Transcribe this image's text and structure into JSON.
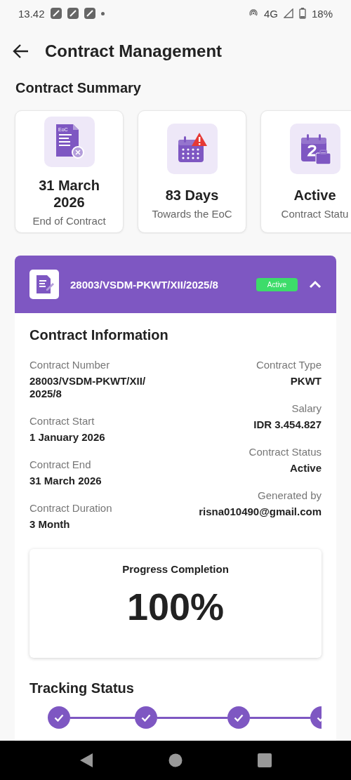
{
  "status_bar": {
    "time": "13.42",
    "network": "4G",
    "battery": "18%"
  },
  "header": {
    "title": "Contract Management"
  },
  "summary": {
    "title": "Contract Summary",
    "cards": [
      {
        "kind": "end",
        "icon_text": "EoC",
        "value": "31 March 2026",
        "caption": "End of Contract"
      },
      {
        "kind": "days",
        "value": "83 Days",
        "caption": "Towards the EoC"
      },
      {
        "kind": "status",
        "value": "Active",
        "caption": "Contract Statu"
      }
    ]
  },
  "contract": {
    "number": "28003/VSDM-PKWT/XII/2025/8",
    "badge": "Active",
    "expanded": true,
    "info_title": "Contract Information",
    "left": [
      {
        "label": "Contract Number",
        "value": "28003/VSDM-PKWT/XII/ 2025/8"
      },
      {
        "label": "Contract Start",
        "value": "1 January 2026"
      },
      {
        "label": "Contract End",
        "value": "31 March 2026"
      },
      {
        "label": "Contract Duration",
        "value": "3 Month"
      }
    ],
    "right": [
      {
        "label": "Contract Type",
        "value": "PKWT"
      },
      {
        "label": "Salary",
        "value": "IDR 3.454.827"
      },
      {
        "label": "Contract Status",
        "value": "Active"
      },
      {
        "label": "Generated by",
        "value": "risna010490@gmail.com"
      }
    ],
    "progress": {
      "title": "Progress Completion",
      "value": "100%"
    },
    "tracking": {
      "title": "Tracking Status",
      "steps": [
        {
          "completed": true
        },
        {
          "completed": true
        },
        {
          "completed": true
        },
        {
          "completed": true
        }
      ]
    }
  }
}
